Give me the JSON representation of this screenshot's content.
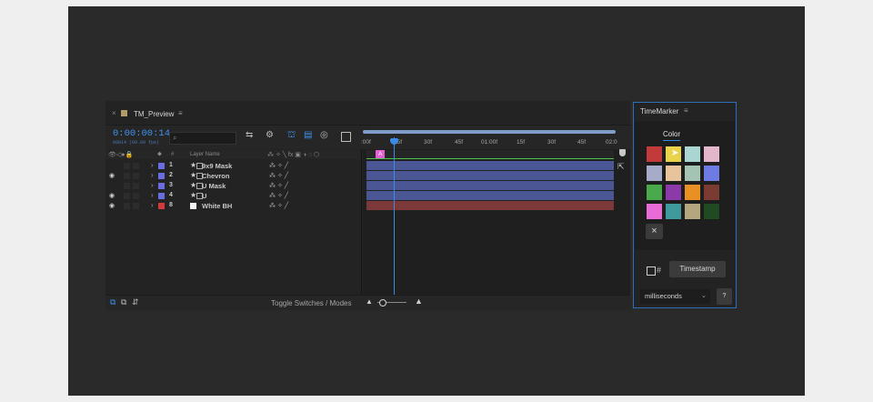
{
  "comp_panel": {
    "tab_name": "TM_Preview",
    "timecode": "0:00:00:14",
    "timecode_sub": "00014 (60.00 fps)",
    "search_placeholder": "",
    "ruler_labels": [
      ":00f",
      "15f",
      "30f",
      "45f",
      "01:00f",
      "15f",
      "30f",
      "45f",
      "02:0"
    ],
    "column_header": {
      "hash": "#",
      "layer_name": "Layer Name"
    },
    "layers": [
      {
        "index": "1",
        "name": "9x9 Mask",
        "color": "#6a6de0",
        "visible": false
      },
      {
        "index": "2",
        "name": "Chevron",
        "color": "#6a6de0",
        "visible": true
      },
      {
        "index": "3",
        "name": "U Mask",
        "color": "#6a6de0",
        "visible": false
      },
      {
        "index": "4",
        "name": "U",
        "color": "#6a6de0",
        "visible": true
      },
      {
        "index": "8",
        "name": "White BH",
        "color": "#d33a3a",
        "visible": true
      }
    ],
    "marker_label": "A",
    "toggle_label": "Toggle Switches / Modes",
    "colors": {
      "layer_bar": "#4b5694",
      "red_bar": "#7d3939",
      "playhead": "#3a8be6",
      "timecode": "#3f92ec",
      "marker": "#e35fd4"
    }
  },
  "timemarker_panel": {
    "title": "TimeMarker",
    "tab_label": "Color",
    "swatches": [
      "#c23a3a",
      "#e8d34b",
      "#a9d5d2",
      "#e3b6cc",
      "#a5abc8",
      "#e7c49b",
      "#a5c3b2",
      "#6e7be3",
      "#4aa94a",
      "#8c39a9",
      "#e99022",
      "#7a3b33",
      "#e86bd8",
      "#3e9a9d",
      "#b5a77d",
      "#1f4a22"
    ],
    "clear_symbol": "×",
    "hash_symbol": "#",
    "timestamp_label": "Timestamp",
    "units_selected": "milliseconds",
    "help_label": "?"
  }
}
